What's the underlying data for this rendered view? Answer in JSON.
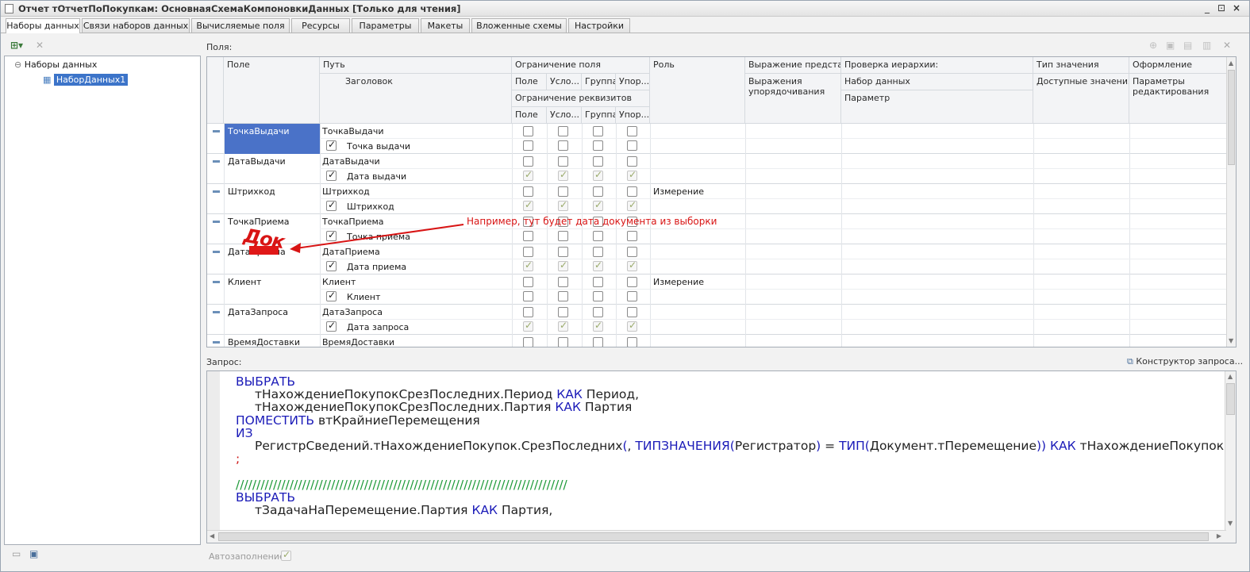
{
  "window": {
    "title": "Отчет тОтчетПоПокупкам: ОсновнаяСхемаКомпоновкиДанных [Только для чтения]",
    "buttons": [
      "_",
      "⊡",
      "×"
    ]
  },
  "tabs": [
    "Наборы данных",
    "Связи наборов данных",
    "Вычисляемые поля",
    "Ресурсы",
    "Параметры",
    "Макеты",
    "Вложенные схемы",
    "Настройки"
  ],
  "tree": {
    "root": "Наборы данных",
    "child": "НаборДанных1"
  },
  "fields_label": "Поля:",
  "grid": {
    "headers": {
      "field": "Поле",
      "path": "Путь",
      "title": "Заголовок",
      "restriction": "Ограничение поля",
      "restr_cols": [
        "Поле",
        "Усло...",
        "Группа",
        "Упор..."
      ],
      "req_restriction": "Ограничение реквизитов",
      "req_cols": [
        "Поле",
        "Усло...",
        "Группа",
        "Упор..."
      ],
      "role": "Роль",
      "expr_view": "Выражение предста...",
      "expr_order": "Выражения упорядочивания",
      "hierarchy": "Проверка иерархии:",
      "dataset": "Набор данных",
      "param": "Параметр",
      "value_type": "Тип значения",
      "avail_values": "Доступные значения",
      "format": "Оформление",
      "edit_params": "Параметры редактирования"
    },
    "rows": [
      {
        "field": "ТочкаВыдачи",
        "path": "ТочкаВыдачи",
        "title": "Точка выдачи",
        "role": "",
        "selected": true,
        "top_checks": [
          false,
          false,
          false,
          false
        ],
        "bottom_checks": [
          false,
          false,
          false,
          false
        ],
        "bottom_disabled": false
      },
      {
        "field": "ДатаВыдачи",
        "path": "ДатаВыдачи",
        "title": "Дата выдачи",
        "role": "",
        "selected": false,
        "top_checks": [
          false,
          false,
          false,
          false
        ],
        "bottom_checks": [
          true,
          true,
          true,
          true
        ],
        "bottom_disabled": true
      },
      {
        "field": "Штрихкод",
        "path": "Штрихкод",
        "title": "Штрихкод",
        "role": "Измерение",
        "selected": false,
        "top_checks": [
          false,
          false,
          false,
          false
        ],
        "bottom_checks": [
          true,
          true,
          true,
          true
        ],
        "bottom_disabled": true
      },
      {
        "field": "ТочкаПриема",
        "path": "ТочкаПриема",
        "title": "Точка приема",
        "role": "",
        "selected": false,
        "top_checks": [
          false,
          false,
          false,
          false
        ],
        "bottom_checks": [
          false,
          false,
          false,
          false
        ],
        "bottom_disabled": false
      },
      {
        "field": "ДатаПриема",
        "path": "ДатаПриема",
        "title": "Дата приема",
        "role": "",
        "selected": false,
        "top_checks": [
          false,
          false,
          false,
          false
        ],
        "bottom_checks": [
          true,
          true,
          true,
          true
        ],
        "bottom_disabled": true
      },
      {
        "field": "Клиент",
        "path": "Клиент",
        "title": "Клиент",
        "role": "Измерение",
        "selected": false,
        "top_checks": [
          false,
          false,
          false,
          false
        ],
        "bottom_checks": [
          false,
          false,
          false,
          false
        ],
        "bottom_disabled": false
      },
      {
        "field": "ДатаЗапроса",
        "path": "ДатаЗапроса",
        "title": "Дата запроса",
        "role": "",
        "selected": false,
        "top_checks": [
          false,
          false,
          false,
          false
        ],
        "bottom_checks": [
          true,
          true,
          true,
          true
        ],
        "bottom_disabled": true
      },
      {
        "field": "ВремяДоставки",
        "path": "ВремяДоставки",
        "title": "",
        "role": "",
        "selected": false,
        "top_checks": [
          false,
          false,
          false,
          false
        ],
        "bottom_checks": [],
        "bottom_disabled": false
      }
    ]
  },
  "annotation": {
    "text": "Например, тут будет дата документа из выборки",
    "scribble": "Док",
    "color": "#d81414"
  },
  "query_label": "Запрос:",
  "query_builder": "Конструктор запроса...",
  "query_lines": [
    {
      "indent": 0,
      "parts": [
        [
          "kw",
          "ВЫБРАТЬ"
        ]
      ]
    },
    {
      "indent": 1,
      "parts": [
        [
          "t",
          "тНахождениеПокупокСрезПоследних.Период "
        ],
        [
          "kw",
          "КАК"
        ],
        [
          "t",
          " Период,"
        ]
      ]
    },
    {
      "indent": 1,
      "parts": [
        [
          "t",
          "тНахождениеПокупокСрезПоследних.Партия "
        ],
        [
          "kw",
          "КАК"
        ],
        [
          "t",
          " Партия"
        ]
      ]
    },
    {
      "indent": 0,
      "parts": [
        [
          "kw",
          "ПОМЕСТИТЬ"
        ],
        [
          "t",
          " втКрайниеПеремещения"
        ]
      ]
    },
    {
      "indent": 0,
      "parts": [
        [
          "kw",
          "ИЗ"
        ]
      ]
    },
    {
      "indent": 1,
      "parts": [
        [
          "t",
          "РегистрСведений.тНахождениеПокупок.СрезПоследних"
        ],
        [
          "kw",
          "("
        ],
        [
          "t",
          ", "
        ],
        [
          "kw",
          "ТИПЗНАЧЕНИЯ"
        ],
        [
          "kw",
          "("
        ],
        [
          "t",
          "Регистратор"
        ],
        [
          "kw",
          ")"
        ],
        [
          "t",
          " = "
        ],
        [
          "kw",
          "ТИП"
        ],
        [
          "kw",
          "("
        ],
        [
          "t",
          "Документ.тПеремещение"
        ],
        [
          "kw",
          "))"
        ],
        [
          "t",
          " "
        ],
        [
          "kw",
          "КАК"
        ],
        [
          "t",
          " тНахождениеПокупок"
        ]
      ]
    },
    {
      "indent": 0,
      "parts": [
        [
          "red",
          ";"
        ]
      ]
    },
    {
      "indent": 0,
      "parts": [
        [
          "t",
          ""
        ]
      ]
    },
    {
      "indent": 0,
      "parts": [
        [
          "cm",
          "////////////////////////////////////////////////////////////////////////////////"
        ]
      ]
    },
    {
      "indent": 0,
      "parts": [
        [
          "kw",
          "ВЫБРАТЬ"
        ]
      ]
    },
    {
      "indent": 1,
      "parts": [
        [
          "t",
          "тЗадачаНаПеремещение.Партия "
        ],
        [
          "kw",
          "КАК"
        ],
        [
          "t",
          " Партия,"
        ]
      ]
    }
  ],
  "autofill": {
    "label": "Автозаполнение",
    "checked": true
  }
}
